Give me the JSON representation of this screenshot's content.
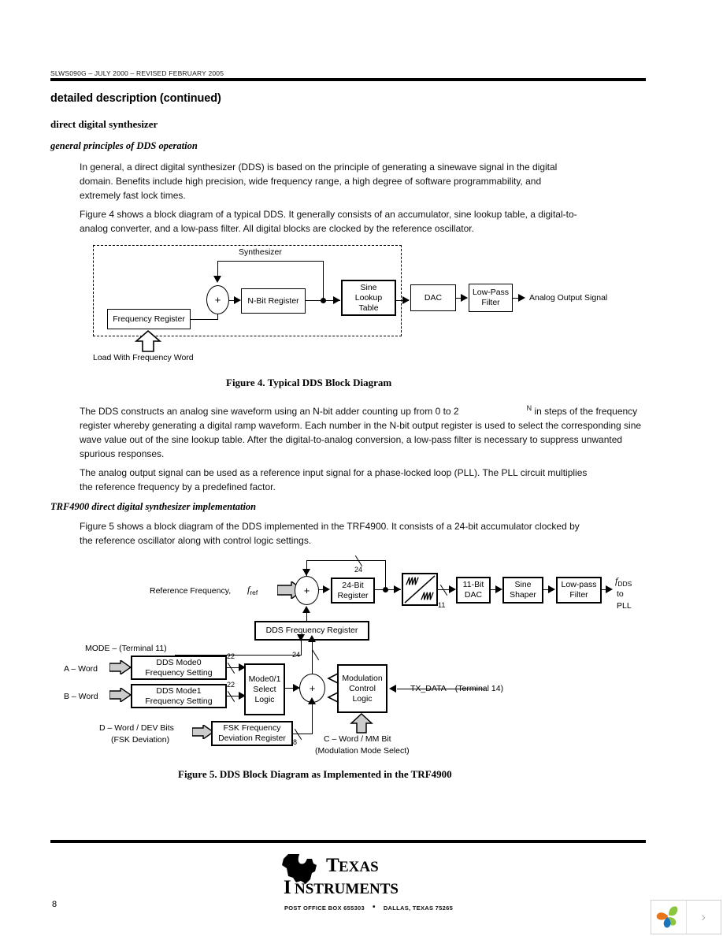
{
  "document": {
    "header_line": "SLWS090G – JULY 2000 – REVISED FEBRUARY 2005",
    "page_number": "8"
  },
  "headings": {
    "section": "detailed description (continued)",
    "sub": "direct digital synthesizer",
    "subsub": "general principles of DDS operation",
    "subsub2": "TRF4900 direct digital synthesizer implementation"
  },
  "paragraphs": {
    "p1": "In general, a direct digital synthesizer (DDS) is based on the principle of generating a sinewave signal in the digital domain. Benefits include high precision, wide frequency range, a high degree of software programmability, and extremely fast lock times.",
    "p2": "Figure 4 shows a block diagram of a typical DDS. It generally consists of an accumulator, sine lookup table, a digital-to-analog converter, and a low-pass filter. All digital blocks are clocked by the reference oscillator.",
    "p3_a": "The DDS constructs an analog sine waveform using an N-bit adder counting up from 0 to 2",
    "p3_sup": "N",
    "p3_b": "in steps of the frequency register whereby generating a digital ramp waveform. Each number in the N-bit output register is used to select the corresponding sine wave value out of the sine lookup table. After the digital-to-analog conversion, a low-pass filter is necessary to suppress unwanted spurious responses.",
    "p4": "The analog output signal can be used as a reference input signal for a phase-locked loop (PLL). The PLL circuit multiplies the reference frequency by a predefined factor.",
    "p5": "Figure 5 shows a block diagram of the DDS implemented in the TRF4900. It consists of a 24-bit accumulator clocked by the reference oscillator along with control logic settings."
  },
  "figure4": {
    "caption": "Figure 4. Typical DDS Block Diagram",
    "synthesizer_label": "Synthesizer",
    "adder_symbol": "+",
    "blocks": {
      "frequency_register": "Frequency Register",
      "n_bit_register": "N-Bit Register",
      "sine_lookup_table_l1": "Sine",
      "sine_lookup_table_l2": "Lookup",
      "sine_lookup_table_l3": "Table",
      "dac": "DAC",
      "low_pass_filter_l1": "Low-Pass",
      "low_pass_filter_l2": "Filter"
    },
    "output_label": "Analog Output Signal",
    "load_label": "Load With Frequency Word"
  },
  "figure5": {
    "caption": "Figure 5. DDS Block Diagram as Implemented in the TRF4900",
    "ref_freq_label": "Reference Frequency,",
    "f_ref_base": "f",
    "f_ref_sub": "ref",
    "adder_symbol": "+",
    "adder2_symbol": "+",
    "bus_24_top": "24",
    "bus_24_mid": "24",
    "bus_11": "11",
    "bus_22_a": "22",
    "bus_22_b": "22",
    "bus_8": "8",
    "blocks": {
      "reg24_l1": "24-Bit",
      "reg24_l2": "Register",
      "dac11_l1": "11-Bit",
      "dac11_l2": "DAC",
      "sine_shaper_l1": "Sine",
      "sine_shaper_l2": "Shaper",
      "lpf_l1": "Low-pass",
      "lpf_l2": "Filter",
      "dds_freq_reg": "DDS Frequency Register",
      "mode0_l1": "DDS Mode0",
      "mode0_l2": "Frequency Setting",
      "mode1_l1": "DDS Mode1",
      "mode1_l2": "Frequency Setting",
      "select_logic_l1": "Mode0/1",
      "select_logic_l2": "Select",
      "select_logic_l3": "Logic",
      "mod_ctrl_l1": "Modulation",
      "mod_ctrl_l2": "Control",
      "mod_ctrl_l3": "Logic",
      "fsk_reg_l1": "FSK Frequency",
      "fsk_reg_l2": "Deviation Register"
    },
    "output": {
      "f_base": "f",
      "f_sub": "DDS",
      "to": "to",
      "pll": "PLL"
    },
    "labels": {
      "mode_terminal": "MODE – (Terminal 11)",
      "a_word": "A – Word",
      "b_word": "B – Word",
      "tx_data": "TX_DATA – (Terminal 14)",
      "d_word_l1": "D – Word / DEV Bits",
      "d_word_l2": "(FSK Deviation)",
      "c_word_l1": "C – Word / MM Bit",
      "c_word_l2": "(Modulation Mode Select)"
    }
  },
  "footer": {
    "company_line1": "TEXAS",
    "company_line2": "INSTRUMENTS",
    "address_left": "POST OFFICE BOX 655303",
    "address_bullet": "•",
    "address_right": "DALLAS, TEXAS 75265"
  },
  "viewer": {
    "next_chevron": "›"
  },
  "colors": {
    "ink": "#000000",
    "rule": "#000000",
    "arrow_fill": "#d0d0d0",
    "logo_orange": "#e8751a",
    "logo_green": "#8cc63f",
    "logo_blue": "#1b75bc"
  }
}
